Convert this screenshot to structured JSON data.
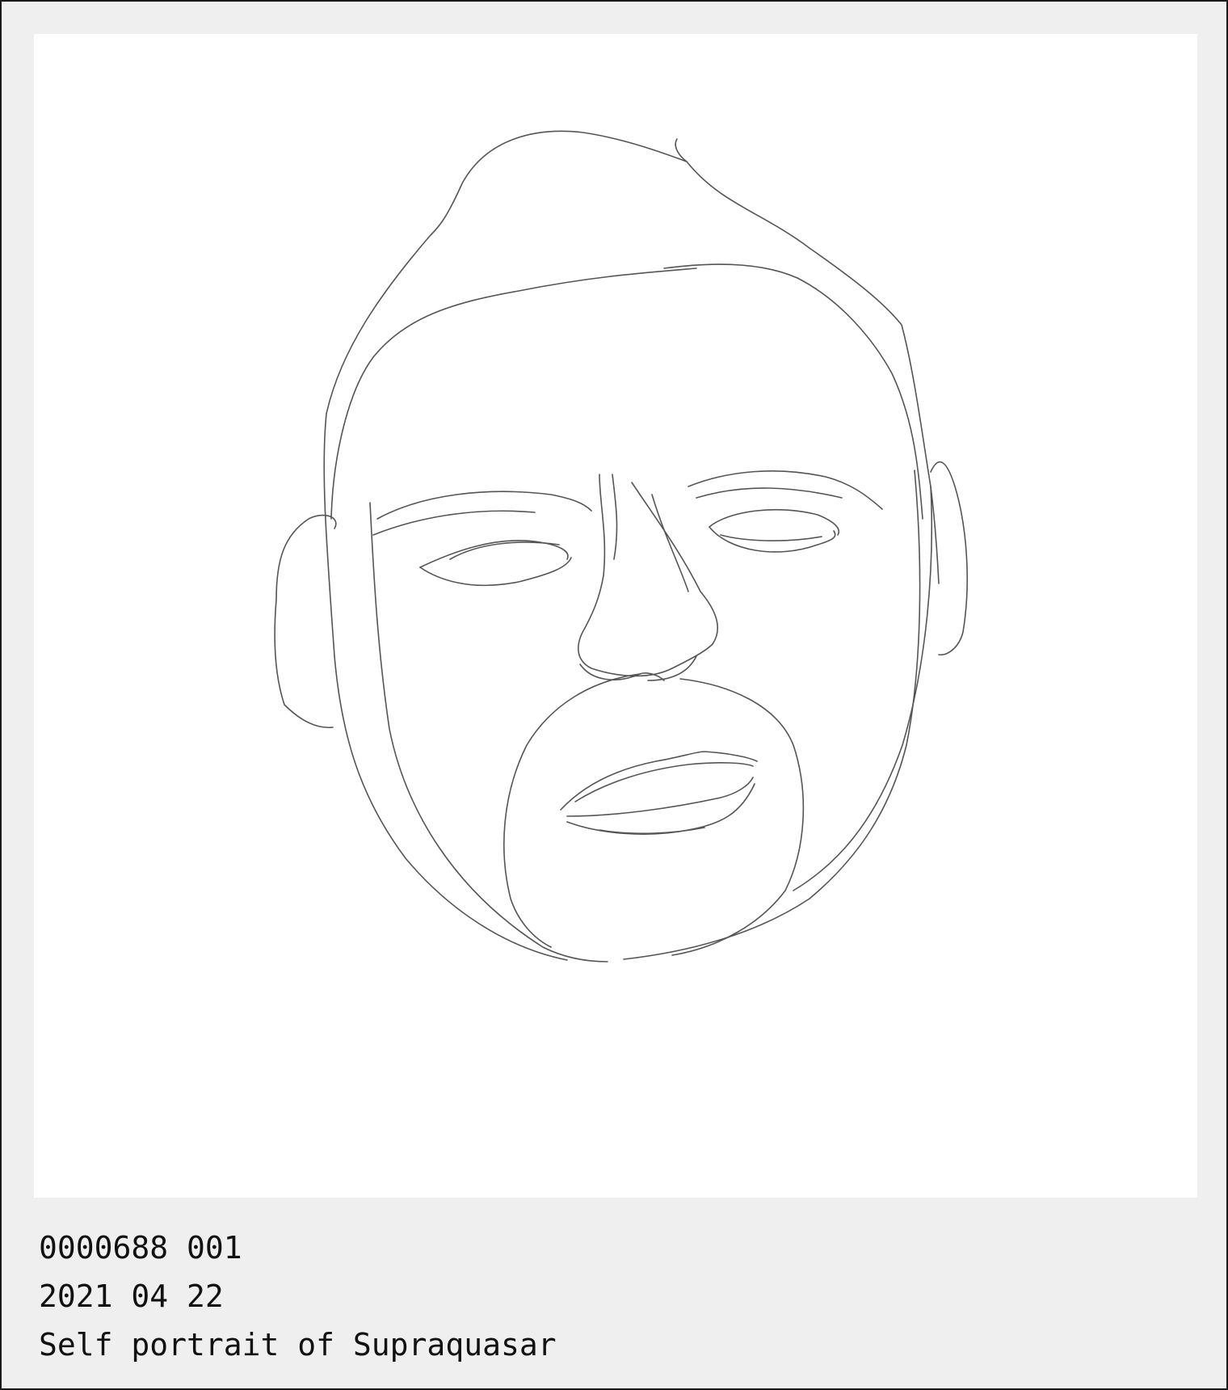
{
  "artwork": {
    "subject_icon": "line-drawing-face"
  },
  "caption": {
    "id_line": "0000688 001",
    "date_line": "2021 04 22",
    "title_line": "Self portrait of Supraquasar"
  },
  "colors": {
    "background": "#efefef",
    "canvas": "#ffffff",
    "stroke": "#555555",
    "text": "#111111"
  }
}
